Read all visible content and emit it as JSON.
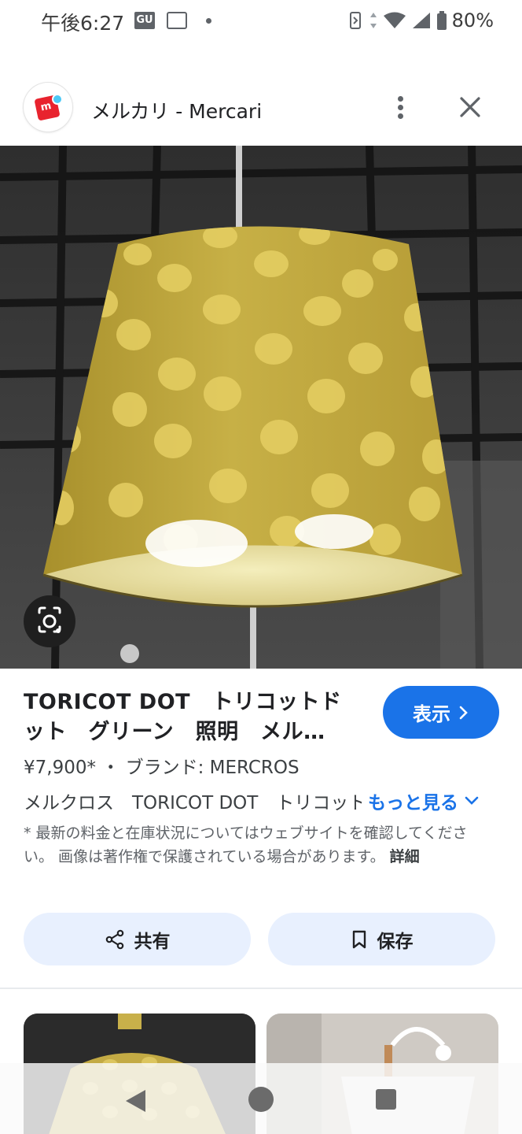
{
  "status_bar": {
    "time": "午後6:27",
    "notif_gu": "GU",
    "battery": "80%"
  },
  "header": {
    "title": "メルカリ - Mercari",
    "logo_letter": "m",
    "icons": [
      "mercari-logo",
      "more-vert-icon",
      "close-icon"
    ]
  },
  "hero": {
    "icon": "google-lens-icon"
  },
  "product": {
    "title": "TORICOT DOT　トリコットドット　グリーン　照明　メル…",
    "view_button": "表示",
    "meta": "¥7,900* ・ ブランド: MERCROS",
    "description": "メルクロス　TORICOT DOT　トリコットドット",
    "more_link": "もっと見る",
    "note": "* 最新の料金と在庫状況についてはウェブサイトを確認してください。 画像は著作権で保護されている場合があります。",
    "note_detail": "詳細"
  },
  "actions": {
    "share_label": "共有",
    "save_label": "保存"
  },
  "colors": {
    "accent": "#1a73e8",
    "action_bg": "#e8f0fe",
    "lamp": "#c9b24a"
  }
}
